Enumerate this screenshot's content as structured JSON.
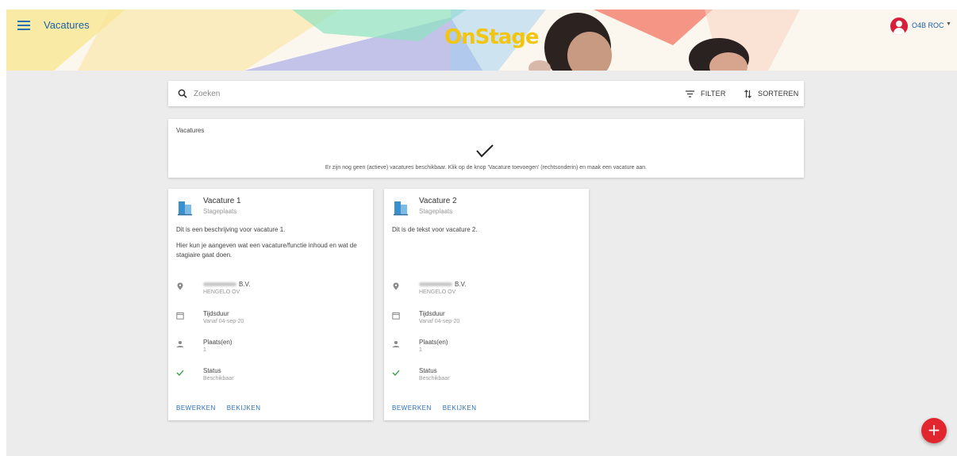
{
  "header": {
    "title": "Vacatures",
    "logo_text": "OnStage",
    "user_name": "O4B ROC",
    "accent_color": "#1e5fa6",
    "avatar_color": "#d71f3a"
  },
  "toolbar": {
    "search_placeholder": "Zoeken",
    "filter_label": "FILTER",
    "sort_label": "SORTEREN"
  },
  "panel": {
    "title": "Vacatures",
    "message": "Er zijn nog geen (actieve) vacatures beschikbaar. Klik op de knop 'Vacature toevoegen' (rechtsonderin) en maak een vacature aan."
  },
  "cards": [
    {
      "title": "Vacature 1",
      "subtitle": "Stageplaats",
      "description": [
        "Dit is een beschrijving voor vacature 1.",
        "Hier kun je aangeven wat een vacature/functie inhoud en wat de stagiaire gaat doen."
      ],
      "company_suffix": "B.V.",
      "location": "HENGELO OV",
      "duration_label": "Tijdsduur",
      "duration_value": "Vanaf 04-sep-20",
      "places_label": "Plaats(en)",
      "places_value": "1",
      "status_label": "Status",
      "status_value": "Beschikbaar",
      "edit_label": "BEWERKEN",
      "view_label": "BEKIJKEN"
    },
    {
      "title": "Vacature 2",
      "subtitle": "Stageplaats",
      "description": [
        "Dit is de tekst voor vacature 2."
      ],
      "company_suffix": "B.V.",
      "location": "HENGELO OV",
      "duration_label": "Tijdsduur",
      "duration_value": "Vanaf 04-sep-20",
      "places_label": "Plaats(en)",
      "places_value": "1",
      "status_label": "Status",
      "status_value": "Beschikbaar",
      "edit_label": "BEWERKEN",
      "view_label": "BEKIJKEN"
    }
  ],
  "fab": {
    "symbol": "+",
    "color": "#e2262f"
  },
  "icons": [
    "menu-icon",
    "user-icon",
    "search-icon",
    "filter-icon",
    "sort-icon",
    "check-icon",
    "building-icon",
    "location-pin-icon",
    "calendar-icon",
    "person-icon",
    "add-icon"
  ]
}
